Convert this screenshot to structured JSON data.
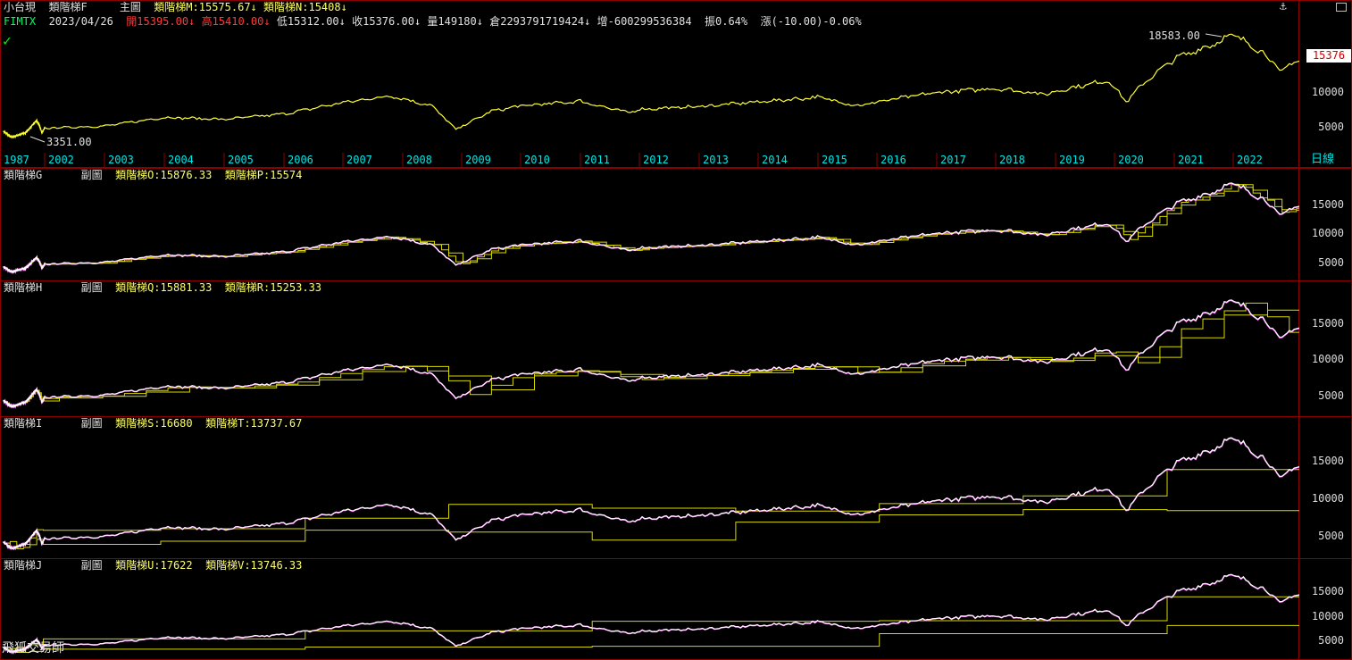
{
  "main": {
    "symbol": "小台現",
    "indicator_name": "類階梯F",
    "chart_label": "主圖",
    "ind_m": "類階梯M:15575.67",
    "ind_n": "類階梯N:15408",
    "code": "FIMTX",
    "date": "2023/04/26",
    "open": "開15395.00",
    "high": "高15410.00",
    "low": "低15312.00",
    "close": "收15376.00",
    "volume": "量149180",
    "position": "倉2293791719424",
    "increase": "增-600299536384",
    "amplitude": "振0.64%",
    "change": "漲(-10.00)-0.06%",
    "max_label": "18583.00",
    "min_label": "3351.00",
    "last_price": "15376",
    "y_labels": [
      "10000",
      "5000"
    ],
    "years": [
      "1987",
      "2002",
      "2003",
      "2004",
      "2005",
      "2006",
      "2007",
      "2008",
      "2009",
      "2010",
      "2011",
      "2012",
      "2013",
      "2014",
      "2015",
      "2016",
      "2017",
      "2018",
      "2019",
      "2020",
      "2021",
      "2022"
    ],
    "period": "日線"
  },
  "panel_g": {
    "name": "類階梯G",
    "chart_label": "副圖",
    "a": "類階梯O:15876.33",
    "b": "類階梯P:15574",
    "y_labels": [
      "15000",
      "10000",
      "5000"
    ]
  },
  "panel_h": {
    "name": "類階梯H",
    "chart_label": "副圖",
    "a": "類階梯Q:15881.33",
    "b": "類階梯R:15253.33",
    "y_labels": [
      "15000",
      "10000",
      "5000"
    ]
  },
  "panel_i": {
    "name": "類階梯I",
    "chart_label": "副圖",
    "a": "類階梯S:16680",
    "b": "類階梯T:13737.67",
    "y_labels": [
      "15000",
      "10000",
      "5000"
    ]
  },
  "panel_j": {
    "name": "類階梯J",
    "chart_label": "副圖",
    "a": "類階梯U:17622",
    "b": "類階梯V:13746.33",
    "y_labels": [
      "15000",
      "10000",
      "5000"
    ]
  },
  "watermark": "飛狐交易師",
  "icons": {
    "anchor": "anchor-icon",
    "check": "checkmark-icon"
  },
  "colors": {
    "price": "#ffff33",
    "ladder": "#d8d800",
    "candle_up": "#ffffff",
    "candle_dn": "#ff55ff",
    "frame": "#8b0000",
    "axis_text": "#00e5e5"
  },
  "chart_data": {
    "type": "line",
    "x": [
      1987,
      1990,
      1995,
      1999,
      2000,
      2001,
      2002,
      2003,
      2004,
      2005,
      2006,
      2007,
      2007.8,
      2008.5,
      2008.9,
      2009.5,
      2010,
      2011,
      2011.8,
      2012,
      2013,
      2014,
      2015,
      2015.7,
      2016,
      2017,
      2018,
      2018.9,
      2019,
      2019.9,
      2020.2,
      2020.5,
      2021,
      2021.6,
      2022,
      2022.5,
      2022.8,
      2023,
      2023.3
    ],
    "values": [
      4200,
      3351,
      4000,
      5800,
      5200,
      4000,
      4700,
      5000,
      6300,
      6000,
      6800,
      8500,
      9500,
      8000,
      4500,
      7200,
      8000,
      8700,
      7000,
      7500,
      7900,
      8600,
      9300,
      8000,
      8600,
      10000,
      10600,
      9700,
      10200,
      11800,
      8600,
      11500,
      15000,
      17000,
      18583,
      16000,
      13000,
      14500,
      15376
    ],
    "ylim": [
      2500,
      19500
    ],
    "title": "小台現 FIMTX"
  }
}
